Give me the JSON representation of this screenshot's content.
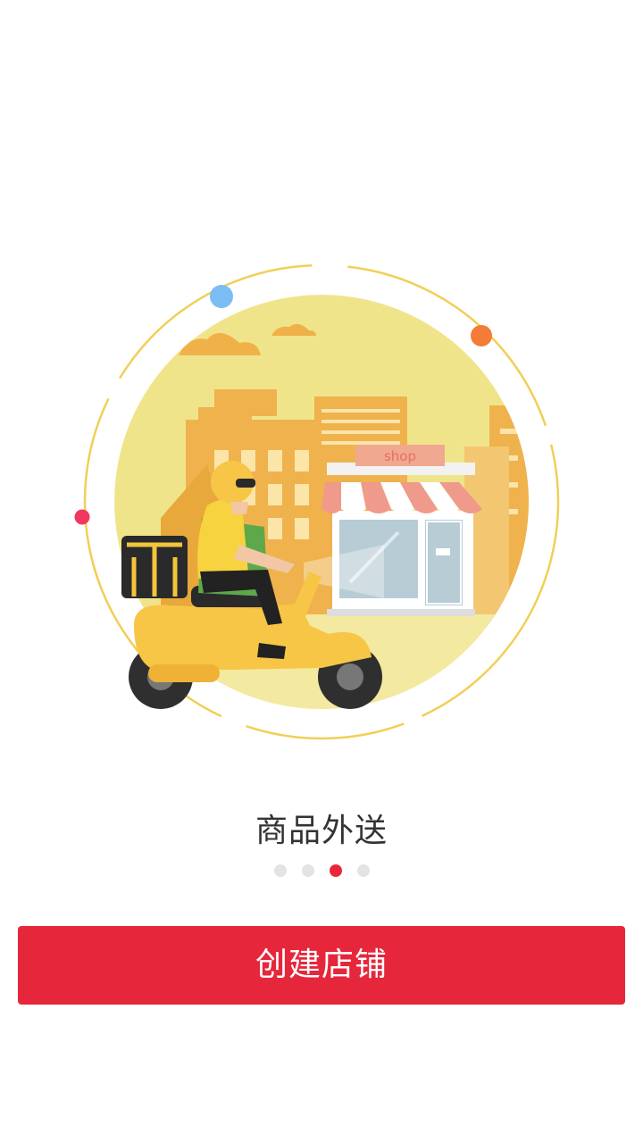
{
  "illustration": {
    "shop_sign": "shop",
    "colors": {
      "sky": "#f0e48b",
      "building": "#efb24c",
      "scooter": "#f7c646",
      "awning": "#ef9a8a"
    }
  },
  "slide": {
    "title": "商品外送"
  },
  "pager": {
    "count": 4,
    "active_index": 2
  },
  "cta": {
    "label": "创建店铺",
    "color": "#e6273b"
  }
}
